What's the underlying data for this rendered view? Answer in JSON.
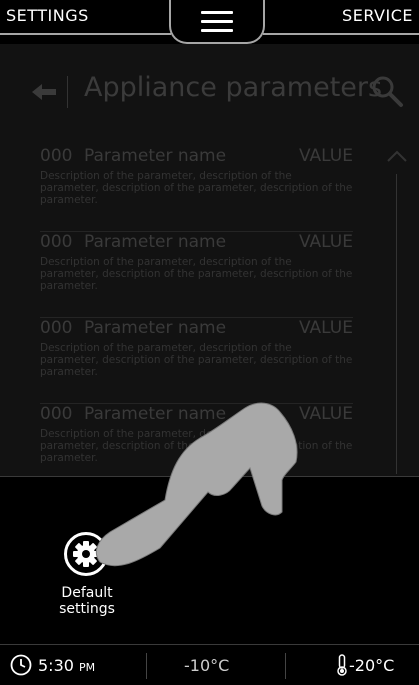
{
  "topbar": {
    "left_label": "SETTINGS",
    "right_label": "SERVICE",
    "menu_icon": "hamburger-icon"
  },
  "screen": {
    "title": "Appliance parameters",
    "back_icon": "back-arrow-icon",
    "search_icon": "search-icon",
    "params": [
      {
        "code": "000",
        "name": "Parameter name",
        "value": "VALUE",
        "description": "Description of the parameter, description of the parameter, description of the parameter, description of the parameter."
      },
      {
        "code": "000",
        "name": "Parameter name",
        "value": "VALUE",
        "description": "Description of the parameter, description of the parameter, description of the parameter, description of the parameter."
      },
      {
        "code": "000",
        "name": "Parameter name",
        "value": "VALUE",
        "description": "Description of the parameter, description of the parameter, description of the parameter, description of the parameter."
      },
      {
        "code": "000",
        "name": "Parameter name",
        "value": "VALUE",
        "description": "Description of the parameter, description of the parameter, description of the parameter, description of the parameter."
      }
    ]
  },
  "panel": {
    "default_settings_label": "Default settings",
    "gear_icon": "gear-icon"
  },
  "status": {
    "time": "5:30",
    "ampm": "PM",
    "temp_fridge": "-10°C",
    "temp_freezer": "-20°C",
    "clock_icon": "clock-icon",
    "thermometer_icon": "thermometer-icon"
  },
  "colors": {
    "background": "#000000",
    "dim_text": "#3a3a3a",
    "accent_line": "#a6a6a6"
  }
}
